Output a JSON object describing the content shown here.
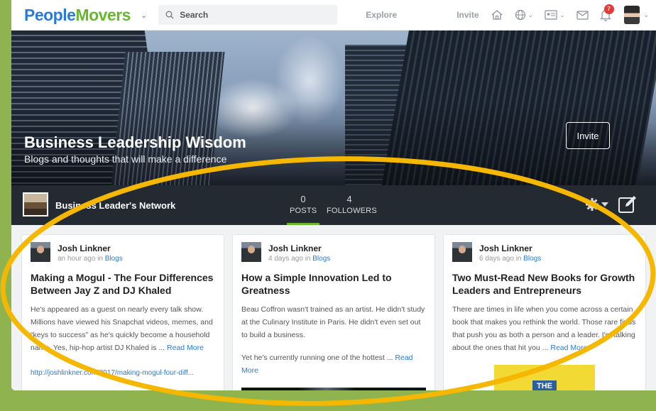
{
  "nav": {
    "logo_part1": "People",
    "logo_part2": "Movers",
    "search_placeholder": "Search",
    "explore": "Explore",
    "invite": "Invite",
    "notification_count": "7",
    "icons": [
      "home-icon",
      "globe-icon",
      "contact-card-icon",
      "mail-icon",
      "bell-icon"
    ]
  },
  "hero": {
    "title": "Business Leadership Wisdom",
    "subtitle": "Blogs and thoughts that will make a difference",
    "invite_button": "Invite"
  },
  "group": {
    "name": "Business Leader's Network",
    "posts_count": "0",
    "posts_label": "POSTS",
    "followers_count": "4",
    "followers_label": "FOLLOWERS"
  },
  "cards": [
    {
      "author": "Josh Linkner",
      "time": "an hour ago in ",
      "where": "Blogs",
      "title": "Making a Mogul - The Four Differences Between Jay Z and DJ Khaled",
      "excerpt": "He's appeared as a guest on nearly every talk show. Millions have viewed his Snapchat videos, memes, and “keys to success” as he's quickly become a household name. Yes, hip-hop artist DJ Khaled is ... ",
      "read_more": "Read More",
      "link": "http://joshlinkner.com/2017/making-mogul-four-diff..."
    },
    {
      "author": "Josh Linkner",
      "time": "4 days ago in ",
      "where": "Blogs",
      "title": "How a Simple Innovation Led to Greatness",
      "excerpt": "Beau Coffron wasn't trained as an artist. He didn't study at the Culinary Institute in Paris. He didn't even set out to build a business.",
      "excerpt2": "Yet he's currently running one of the hottest ... ",
      "read_more": "Read More"
    },
    {
      "author": "Josh Linkner",
      "time": "6 days ago in ",
      "where": "Blogs",
      "title": "Two Must-Read New Books for Growth Leaders and Entrepreneurs",
      "excerpt": "There are times in life when you come across a certain book that makes you rethink the world. Those rare finds that push you as both a person and a leader. I'm talking about the ones that hit you ... ",
      "read_more": "Read More",
      "book_word": "THE"
    }
  ],
  "colors": {
    "brand_blue": "#2a7bd8",
    "brand_green": "#68b72f",
    "highlight_ring": "#f5b700",
    "background": "#8fb44f"
  }
}
